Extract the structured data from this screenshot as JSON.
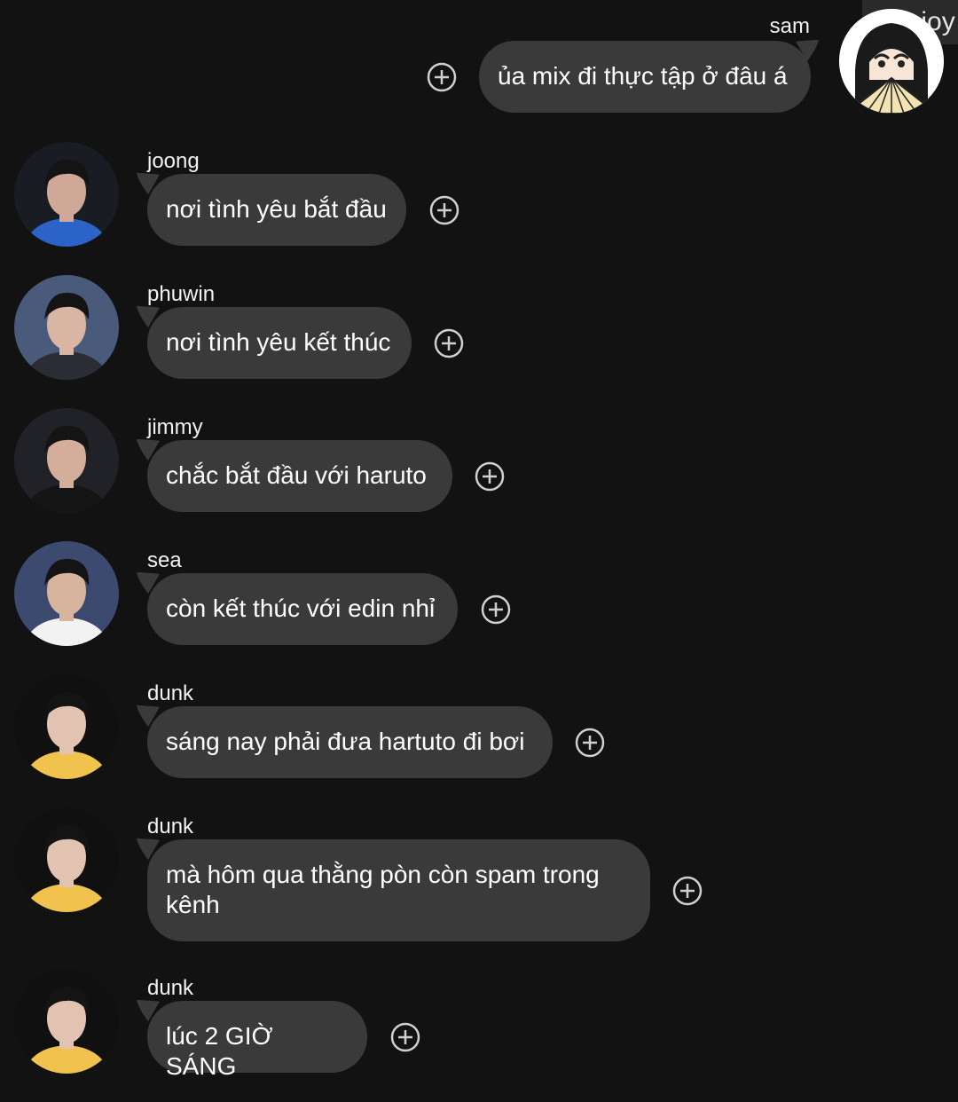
{
  "watermark": "108 joy",
  "sent": {
    "sender": "sam",
    "text": "ủa mix đi thực tập ở đâu á",
    "avatar_icon": "cartoon-girl-fan-avatar"
  },
  "messages": [
    {
      "sender": "joong",
      "text": "nơi tình yêu bắt đầu"
    },
    {
      "sender": "phuwin",
      "text": "nơi tình yêu kết thúc"
    },
    {
      "sender": "jimmy",
      "text": "chắc bắt đầu với haruto"
    },
    {
      "sender": "sea",
      "text": "còn kết thúc với edin nhỉ"
    },
    {
      "sender": "dunk",
      "text": "sáng nay phải đưa hartuto đi bơi"
    },
    {
      "sender": "dunk",
      "text": "mà hôm qua thằng pòn còn spam trong kênh"
    },
    {
      "sender": "dunk",
      "text": "lúc 2 GIỜ SÁNG"
    }
  ],
  "colors": {
    "background": "#121212",
    "bubble": "#3a3a3a",
    "icon": "#d0d0d0"
  }
}
